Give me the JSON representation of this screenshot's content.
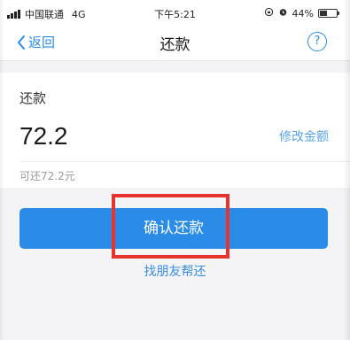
{
  "status_bar": {
    "carrier": "中国联通",
    "network": "4G",
    "time": "下午5:21",
    "battery": "44%"
  },
  "nav": {
    "back_label": "返回",
    "title": "还款",
    "help_symbol": "?"
  },
  "card": {
    "label": "还款",
    "amount": "72.2",
    "modify_label": "修改金额",
    "available": "可还72.2元"
  },
  "actions": {
    "confirm_label": "确认还款",
    "friend_label": "找朋友帮还"
  },
  "colors": {
    "accent": "#2a8ce6",
    "highlight": "#e8322e"
  }
}
